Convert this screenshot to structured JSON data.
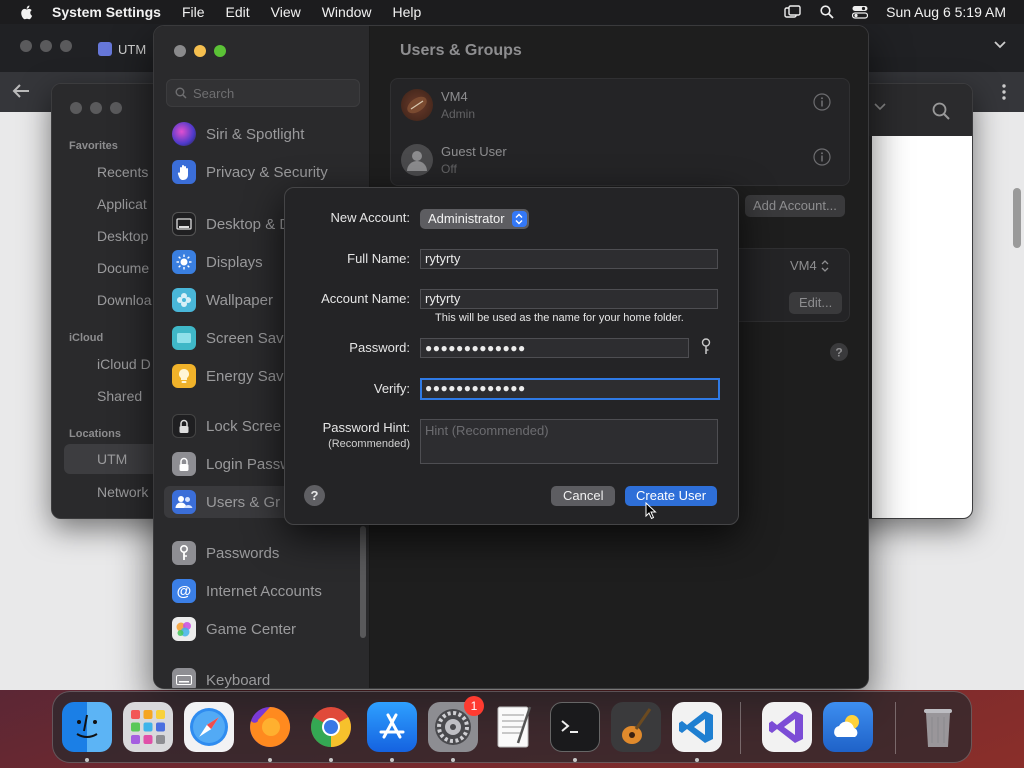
{
  "menubar": {
    "app_name": "System Settings",
    "items": [
      "File",
      "Edit",
      "View",
      "Window",
      "Help"
    ],
    "clock": "Sun Aug 6  5:19 AM"
  },
  "browser": {
    "tab_label": "UTM"
  },
  "finder": {
    "favorites_label": "Favorites",
    "favorites": [
      "Recents",
      "Applicat",
      "Desktop",
      "Docume",
      "Downloa"
    ],
    "icloud_label": "iCloud",
    "icloud": [
      "iCloud D",
      "Shared"
    ],
    "locations_label": "Locations",
    "locations": [
      "UTM",
      "Network"
    ]
  },
  "settings": {
    "search_placeholder": "Search",
    "sidebar": [
      "Siri & Spotlight",
      "Privacy & Security",
      "Desktop & D",
      "Displays",
      "Wallpaper",
      "Screen Sav",
      "Energy Sav",
      "Lock Scree",
      "Login Passw",
      "Users & Gr",
      "Passwords",
      "Internet Accounts",
      "Game Center",
      "Keyboard"
    ],
    "main_title": "Users & Groups",
    "users": [
      {
        "name": "VM4",
        "role": "Admin"
      },
      {
        "name": "Guest User",
        "role": "Off"
      }
    ],
    "add_account_label": "Add Account...",
    "auto_login_value": "VM4",
    "edit_label": "Edit..."
  },
  "sheet": {
    "new_account_label": "New Account:",
    "new_account_value": "Administrator",
    "full_name_label": "Full Name:",
    "full_name_value": "rytyrty",
    "account_name_label": "Account Name:",
    "account_name_value": "rytyrty",
    "account_note": "This will be used as the name for your home folder.",
    "password_label": "Password:",
    "password_value": "●●●●●●●●●●●●●",
    "verify_label": "Verify:",
    "verify_value": "●●●●●●●●●●●●●",
    "hint_label": "Password Hint:",
    "hint_sublabel": "(Recommended)",
    "hint_placeholder": "Hint (Recommended)",
    "help_label": "?",
    "cancel_label": "Cancel",
    "create_label": "Create User"
  },
  "dock": {
    "settings_badge": "1"
  }
}
